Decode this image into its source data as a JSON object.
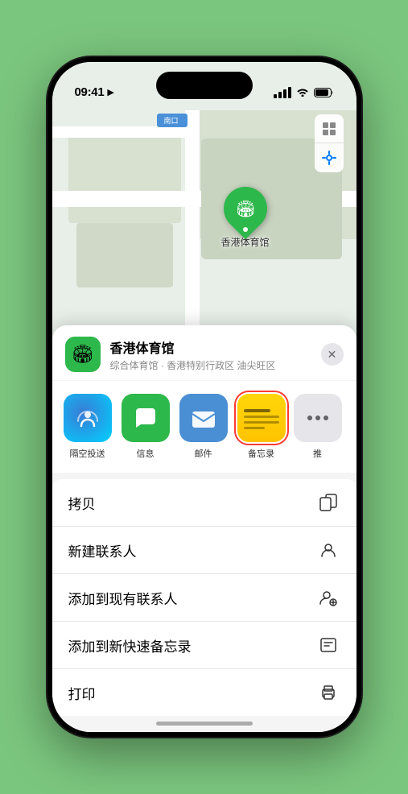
{
  "status": {
    "time": "09:41",
    "location_arrow": "▲"
  },
  "map": {
    "south_entrance": "南口"
  },
  "place": {
    "name": "香港体育馆",
    "subtitle": "综合体育馆 · 香港特别行政区 油尖旺区",
    "icon": "🏟"
  },
  "share_apps": [
    {
      "id": "airdrop",
      "label": "隔空投送",
      "type": "airdrop"
    },
    {
      "id": "messages",
      "label": "信息",
      "type": "messages"
    },
    {
      "id": "mail",
      "label": "邮件",
      "type": "mail"
    },
    {
      "id": "notes",
      "label": "备忘录",
      "type": "notes",
      "selected": true
    }
  ],
  "actions": [
    {
      "id": "copy",
      "label": "拷贝",
      "icon": "copy"
    },
    {
      "id": "new-contact",
      "label": "新建联系人",
      "icon": "person-add"
    },
    {
      "id": "add-contact",
      "label": "添加到现有联系人",
      "icon": "person-plus"
    },
    {
      "id": "add-note",
      "label": "添加到新快速备忘录",
      "icon": "note-add"
    },
    {
      "id": "print",
      "label": "打印",
      "icon": "print"
    }
  ]
}
